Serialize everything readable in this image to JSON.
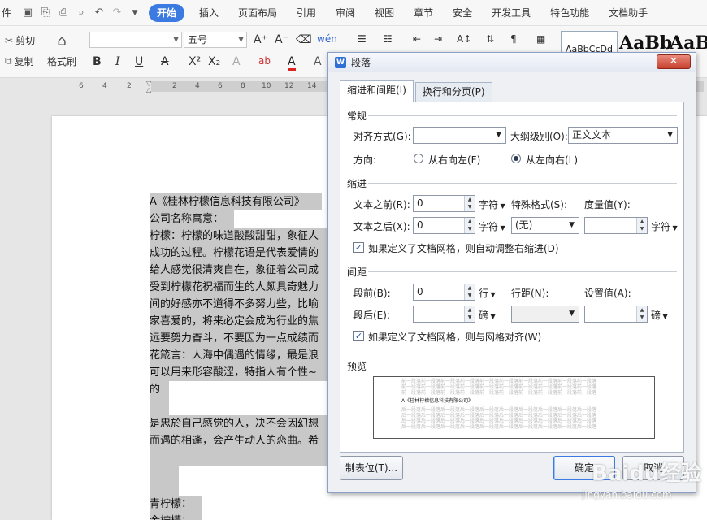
{
  "menubar": {
    "file_fragment": "件",
    "tabs": [
      "开始",
      "插入",
      "页面布局",
      "引用",
      "审阅",
      "视图",
      "章节",
      "安全",
      "开发工具",
      "特色功能",
      "文档助手"
    ]
  },
  "ribbon": {
    "cut": "剪切",
    "copy": "复制",
    "format_painter": "格式刷",
    "font_name": "",
    "font_size": "五号",
    "style_normal": "AaBbCcDd",
    "style_heading1": "AaBb",
    "style_heading2": "AaBb"
  },
  "ruler": {
    "ticks": [
      "6",
      "4",
      "2",
      "2",
      "4",
      "6",
      "8",
      "10",
      "12",
      "14",
      "16",
      "18",
      "20",
      "22",
      "24",
      "26",
      "28"
    ]
  },
  "document": {
    "lines": [
      "A《桂林柠檬信息科技有限公司》",
      "公司名称寓意：",
      "柠檬：柠檬的味道酸酸甜甜，象征人",
      "成功的过程。柠檬花语是代表爱情的",
      "给人感觉很清爽自在，象征着公司成",
      "受到柠檬花祝福而生的人颇具奇魅力",
      "间的好感亦不道得不多努力些，比喻",
      "家喜爱的，将来必定会成为行业的焦",
      "远要努力奋斗，不要因为一点成绩而",
      "花箴言：人海中偶遇的情缘，最是浪",
      "可以用来形容酸涩，特指人有个性~",
      "的",
      "",
      "是忠於自己感觉的人，决不会因幻想",
      "而遇的相逢，会产生动人的恋曲。希",
      "",
      "",
      "青柠檬：",
      "金柠檬："
    ]
  },
  "dialog": {
    "title": "段落",
    "tabs": [
      "缩进和间距(I)",
      "换行和分页(P)"
    ],
    "general": {
      "heading": "常规",
      "alignment_label": "对齐方式(G):",
      "alignment_value": "",
      "outline_label": "大纲级别(O):",
      "outline_value": "正文文本",
      "direction_label": "方向:",
      "rtl": "从右向左(F)",
      "ltr": "从左向右(L)"
    },
    "indent": {
      "heading": "缩进",
      "before_label": "文本之前(R):",
      "before_value": "0",
      "before_unit": "字符",
      "special_label": "特殊格式(S):",
      "special_value": "(无)",
      "measure_label": "度量值(Y):",
      "measure_value": "",
      "measure_unit": "字符",
      "after_label": "文本之后(X):",
      "after_value": "0",
      "after_unit": "字符",
      "grid_indent": "如果定义了文档网格，则自动调整右缩进(D)"
    },
    "spacing": {
      "heading": "间距",
      "before_label": "段前(B):",
      "before_value": "0",
      "before_unit": "行",
      "line_label": "行距(N):",
      "line_value": "",
      "set_label": "设置值(A):",
      "set_value": "",
      "set_unit": "磅",
      "after_label": "段后(E):",
      "after_value": "",
      "after_unit": "磅",
      "grid_align": "如果定义了文档网格，则与网格对齐(W)"
    },
    "preview": {
      "heading": "预览",
      "sample_gray": "前一段落前一段落前一段落前一段落前一段落前一段落前一段落前一段落前一段落前一段落",
      "sample_main": "A《桂林柠檬信息科技有限公司》",
      "sample_next": "后一段落后一段落后一段落后一段落后一段落后一段落后一段落后一段落后一段落后一段落"
    },
    "buttons": {
      "tabs": "制表位(T)...",
      "ok": "确定",
      "cancel": "取消"
    }
  },
  "watermark": {
    "main": "Baidu经验",
    "sub": "jingyan.baidu.com"
  }
}
